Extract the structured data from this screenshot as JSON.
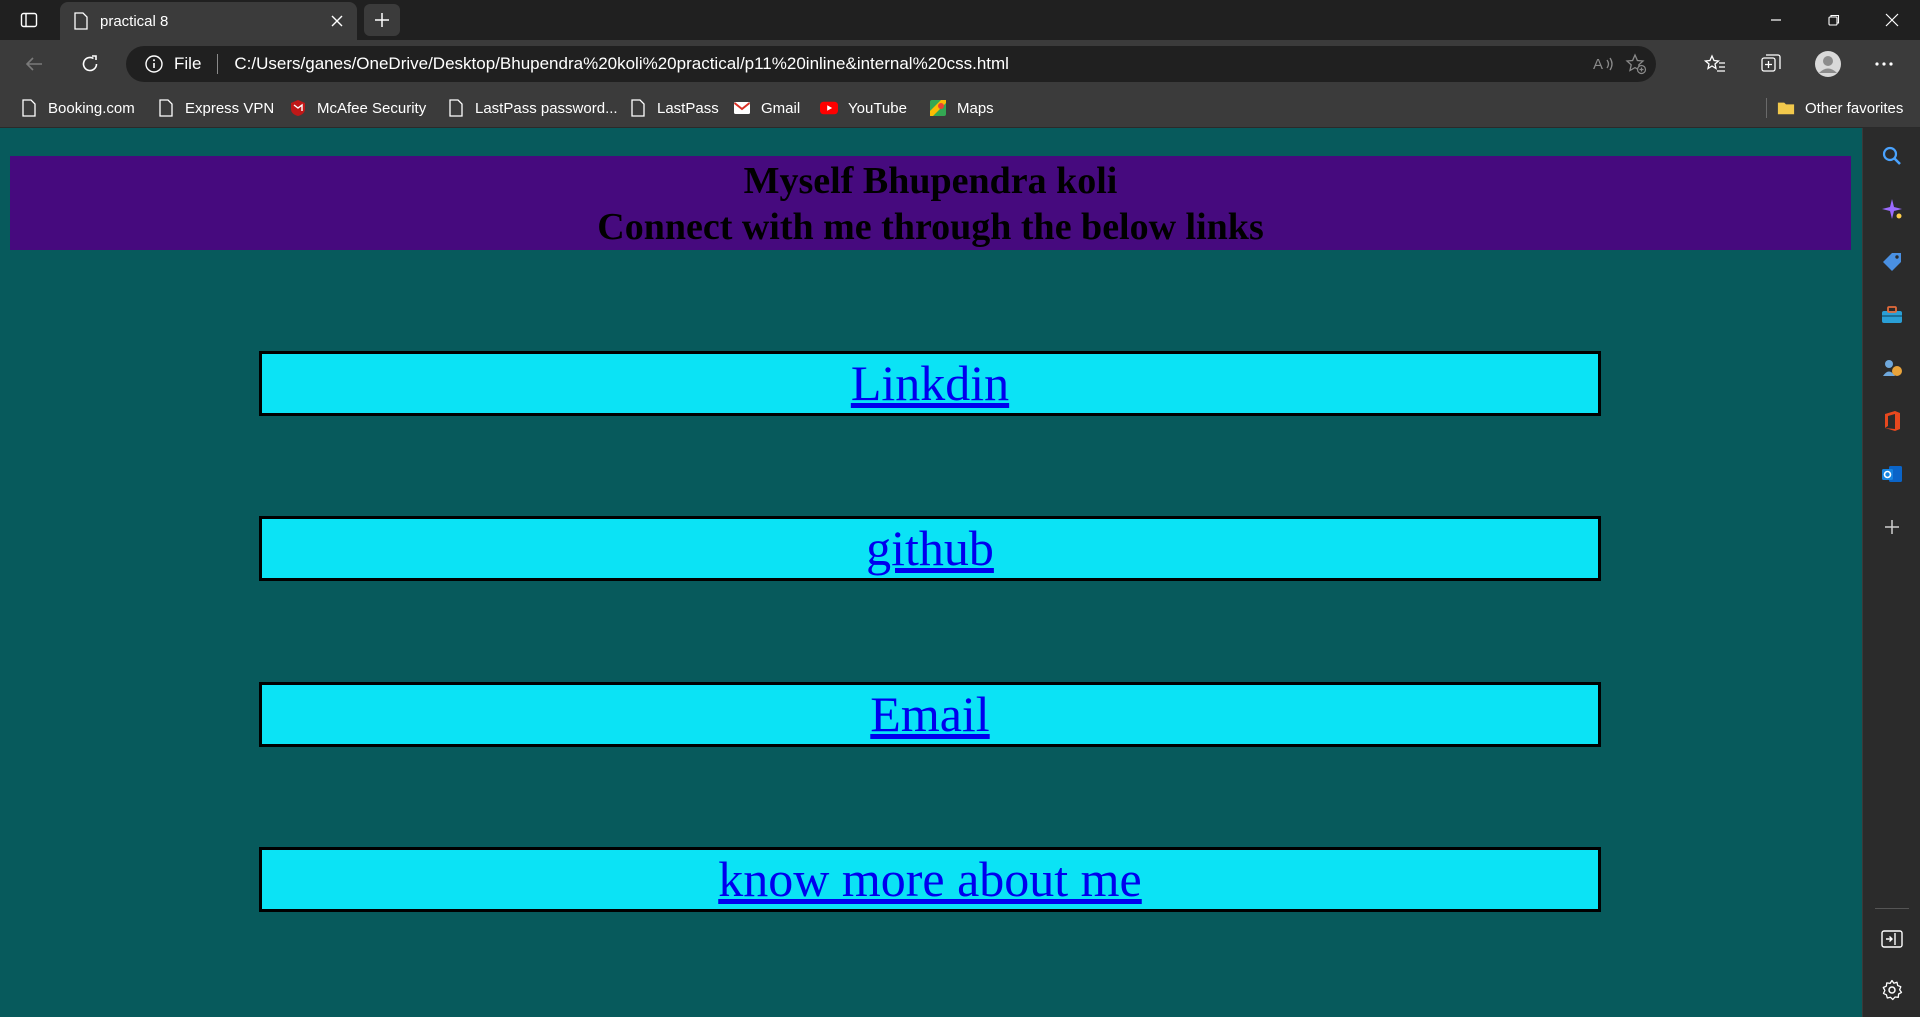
{
  "browser": {
    "tab_title": "practical 8",
    "address_scheme": "File",
    "url": "C:/Users/ganes/OneDrive/Desktop/Bhupendra%20koli%20practical/p11%20inline&internal%20css.html"
  },
  "favorites": [
    {
      "label": "Booking.com",
      "icon": "page-icon"
    },
    {
      "label": "Express VPN",
      "icon": "page-icon"
    },
    {
      "label": "McAfee Security",
      "icon": "mcafee-icon"
    },
    {
      "label": "LastPass password...",
      "icon": "page-icon"
    },
    {
      "label": "LastPass",
      "icon": "page-icon"
    },
    {
      "label": "Gmail",
      "icon": "gmail-icon"
    },
    {
      "label": "YouTube",
      "icon": "youtube-icon"
    },
    {
      "label": "Maps",
      "icon": "maps-icon"
    }
  ],
  "other_favorites": "Other favorites",
  "page": {
    "header_line1": "Myself Bhupendra koli",
    "header_line2": "Connect with me through the below links",
    "links": [
      "Linkdin",
      "github",
      "Email",
      "know more about me"
    ]
  },
  "colors": {
    "page_bg": "#075a5c",
    "header_bg": "#460a7e",
    "link_box_bg": "#0be3f5",
    "link_color": "#0000ee"
  }
}
